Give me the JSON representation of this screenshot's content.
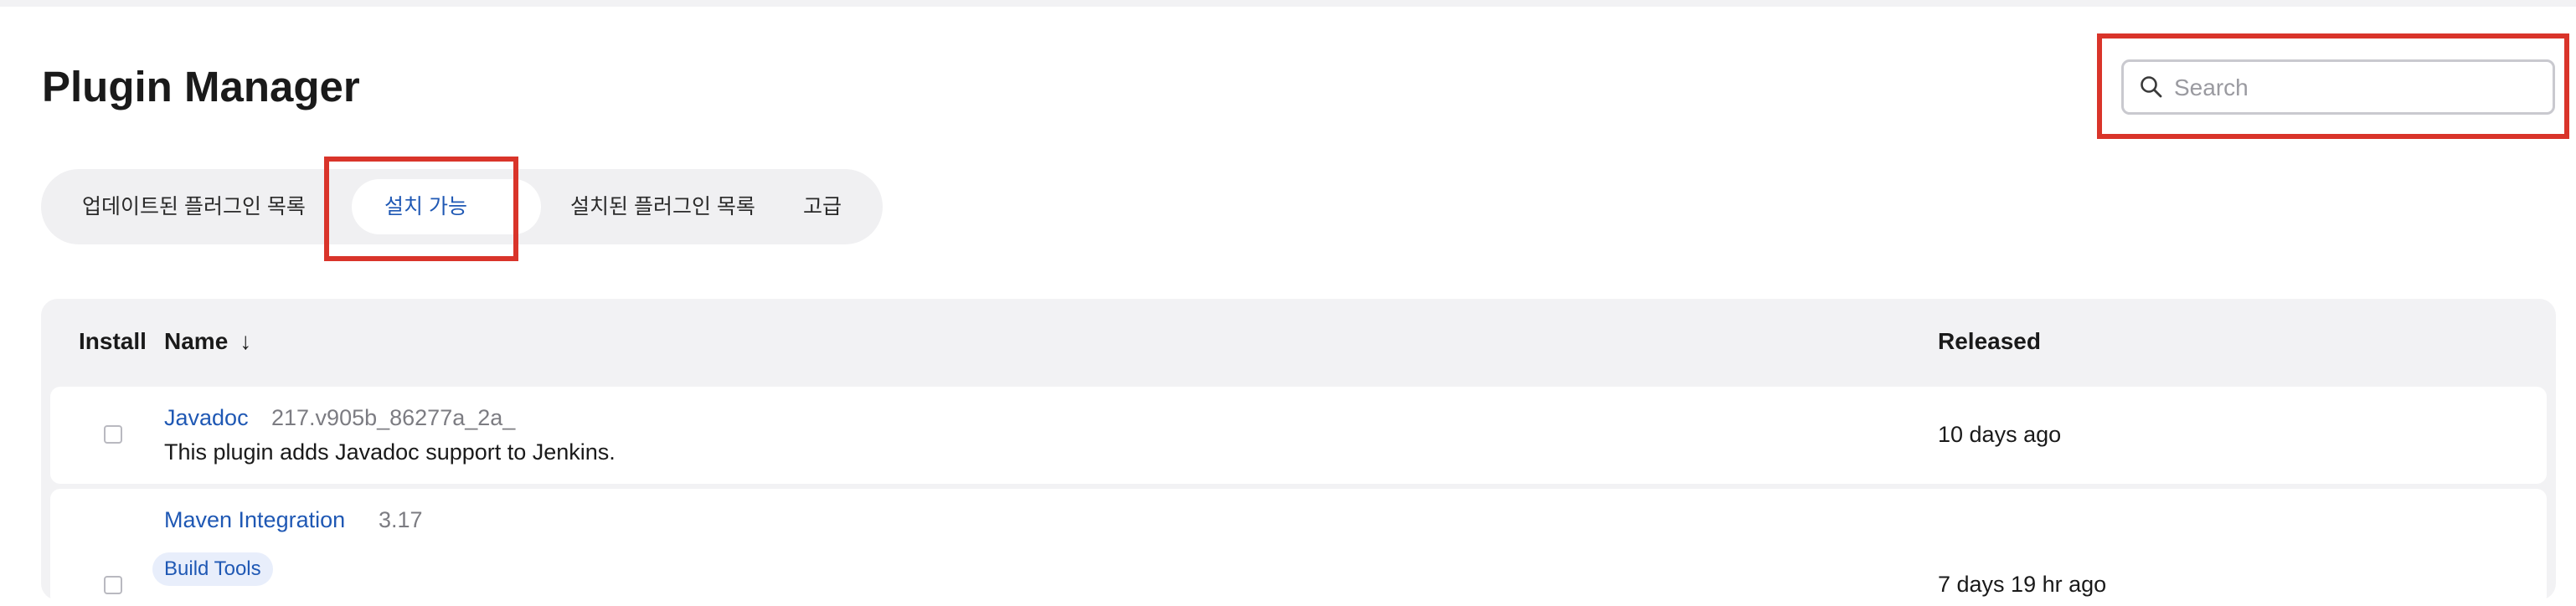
{
  "page": {
    "title": "Plugin Manager"
  },
  "search": {
    "placeholder": "Search",
    "value": ""
  },
  "tabs": [
    {
      "label": "업데이트된 플러그인 목록",
      "active": false
    },
    {
      "label": "설치 가능",
      "active": true
    },
    {
      "label": "설치된 플러그인 목록",
      "active": false
    },
    {
      "label": "고급",
      "active": false
    }
  ],
  "table": {
    "headers": {
      "install": "Install",
      "name": "Name",
      "sort_indicator": "↓",
      "released": "Released"
    },
    "rows": [
      {
        "name": "Javadoc",
        "version": "217.v905b_86277a_2a_",
        "description": "This plugin adds Javadoc support to Jenkins.",
        "tags": [],
        "released": "10 days ago",
        "checked": false
      },
      {
        "name": "Maven Integration",
        "version": "3.17",
        "description": "",
        "tags": [
          "Build Tools"
        ],
        "released": "7 days 19 hr ago",
        "checked": false
      }
    ]
  },
  "colors": {
    "accent_blue": "#1f58b4",
    "highlight_red": "#d9342a",
    "panel_gray": "#f2f2f4"
  },
  "icons": {
    "search": "search-icon",
    "sort": "arrow-down-icon"
  }
}
